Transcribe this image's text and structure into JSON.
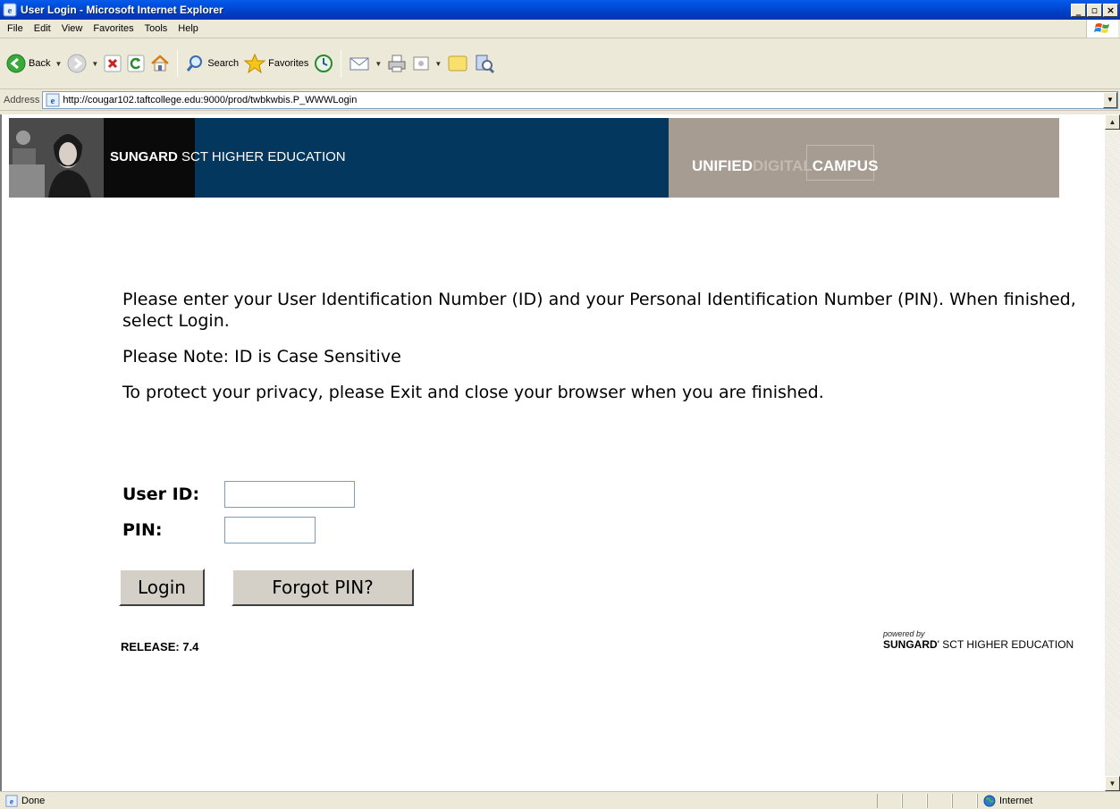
{
  "window": {
    "title": "User Login - Microsoft Internet Explorer",
    "min_glyph": "_",
    "max_glyph": "▫",
    "close_glyph": "×"
  },
  "menu": [
    "File",
    "Edit",
    "View",
    "Favorites",
    "Tools",
    "Help"
  ],
  "toolbar": {
    "back_label": "Back",
    "search_label": "Search",
    "favorites_label": "Favorites"
  },
  "address": {
    "label": "Address",
    "url": "http://cougar102.taftcollege.edu:9000/prod/twbkwbis.P_WWWLogin"
  },
  "banner": {
    "brand_bold": "SUNGARD",
    "brand_rest": " SCT HIGHER EDUCATION",
    "udc_a": "UNIFIED",
    "udc_b": "DIGITAL",
    "udc_c": "CAMPUS"
  },
  "page": {
    "instruction": "Please enter your User Identification Number (ID) and your Personal Identification Number (PIN). When finished, select Login.",
    "note": "Please Note: ID is Case Sensitive",
    "privacy": "To protect your privacy, please Exit and close your browser when you are finished.",
    "userid_label": "User ID:",
    "pin_label": "PIN:",
    "userid_value": "",
    "pin_value": "",
    "login_button": "Login",
    "forgot_button": "Forgot PIN?",
    "release": "RELEASE: 7.4",
    "powered_by": "powered by",
    "powered_brand_bold": "SUNGARD",
    "powered_brand_rest": "' SCT HIGHER EDUCATION"
  },
  "status": {
    "text": "Done",
    "zone": "Internet"
  },
  "colors": {
    "titlebar": "#0040c8",
    "banner_navy": "#04375d",
    "banner_taupe": "#a69c92"
  }
}
